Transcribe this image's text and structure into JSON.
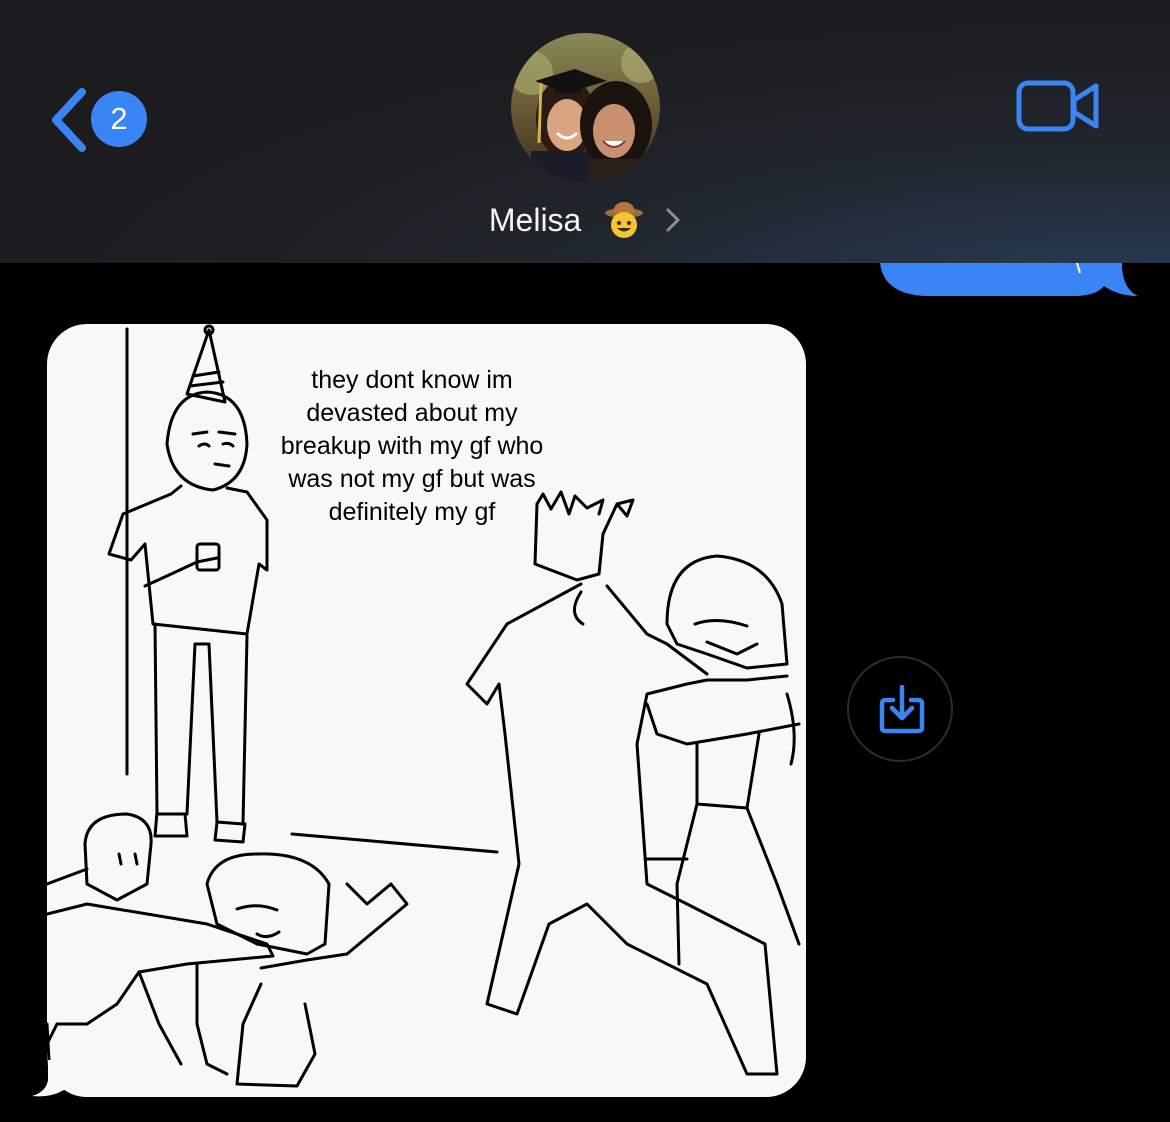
{
  "header": {
    "back_badge": "2",
    "contact_name": "Melisa",
    "name_emoji": "cowboy-face",
    "accent_color": "#3a85f5"
  },
  "message": {
    "meme_caption": [
      "they dont know im",
      "devasted about my",
      "breakup with my gf who",
      "was not my gf but was",
      "definitely my gf"
    ]
  },
  "actions": {
    "save_icon": "download-icon"
  }
}
